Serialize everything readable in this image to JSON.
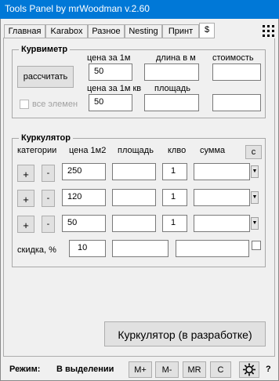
{
  "window": {
    "title": "Tools Panel by mrWoodman v.2.60"
  },
  "tabs": [
    "Главная",
    "Karabox",
    "Разное",
    "Nesting",
    "Принт",
    "$"
  ],
  "kurvimetr": {
    "title": "Курвиметр",
    "labels": {
      "price_per_m": "цена за 1м",
      "length_m": "длина в м",
      "cost": "стоимость",
      "price_per_m2": "цена за 1м кв",
      "area": "площадь",
      "all_elements": "все элемен"
    },
    "calc_button": "рассчитать",
    "values": {
      "price_per_m": "50",
      "length_m": "",
      "cost": "",
      "price_per_m2": "50",
      "area": "",
      "area_cost": ""
    }
  },
  "kurkulator": {
    "title": "Куркулятор",
    "headers": {
      "categories": "категории",
      "price_m2": "цена 1м2",
      "area": "площадь",
      "qty": "клво",
      "sum": "сумма"
    },
    "clear_button": "c",
    "rows": [
      {
        "plus": "+",
        "minus": "-",
        "price": "250",
        "area": "",
        "qty": "1",
        "sum": ""
      },
      {
        "plus": "+",
        "minus": "-",
        "price": "120",
        "area": "",
        "qty": "1",
        "sum": ""
      },
      {
        "plus": "+",
        "minus": "-",
        "price": "50",
        "area": "",
        "qty": "1",
        "sum": ""
      }
    ],
    "discount_label": "скидка, %",
    "discount_value": "10",
    "discount_area": "",
    "total": ""
  },
  "main_button": "Куркулятор (в разработке)",
  "status": {
    "mode_label": "Режим:",
    "mode_value": "В выделении",
    "buttons": [
      "M+",
      "M-",
      "MR",
      "C"
    ],
    "help": "?"
  }
}
